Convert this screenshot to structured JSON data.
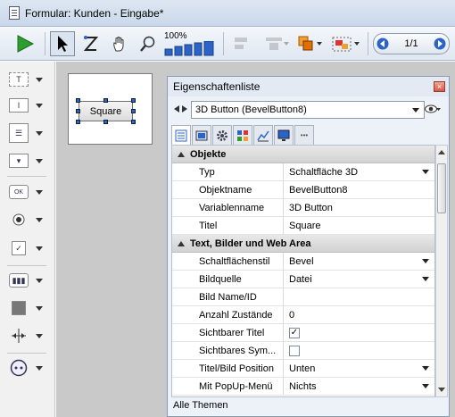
{
  "window": {
    "title": "Formular: Kunden -  Eingabe*"
  },
  "toolbar": {
    "zoom_label": "100%",
    "page_indicator": "1/1"
  },
  "form": {
    "button_label": "Square"
  },
  "panel": {
    "title": "Eigenschaftenliste",
    "close_glyph": "×",
    "object_selector": "3D Button (BevelButton8)",
    "more_tab_glyph": "•••",
    "sections": [
      {
        "label": "Objekte"
      },
      {
        "label": "Text, Bilder und Web Area"
      }
    ],
    "rows": [
      {
        "key": "Typ",
        "value": "Schaltfläche 3D"
      },
      {
        "key": "Objektname",
        "value": "BevelButton8"
      },
      {
        "key": "Variablenname",
        "value": "3D Button"
      },
      {
        "key": "Titel",
        "value": "Square"
      },
      {
        "key": "Schaltflächenstil",
        "value": "Bevel"
      },
      {
        "key": "Bildquelle",
        "value": "Datei"
      },
      {
        "key": "Bild Name/ID",
        "value": ""
      },
      {
        "key": "Anzahl Zustände",
        "value": "0"
      },
      {
        "key": "Sichtbarer Titel",
        "value": "✓"
      },
      {
        "key": "Sichtbares Sym...",
        "value": ""
      },
      {
        "key": "Titel/Bild Position",
        "value": "Unten"
      },
      {
        "key": "Mit PopUp-Menü",
        "value": "Nichts"
      }
    ],
    "footer": "Alle Themen"
  },
  "colors": {
    "accent": "#2b63c9",
    "run_green": "#2e9d2e"
  }
}
